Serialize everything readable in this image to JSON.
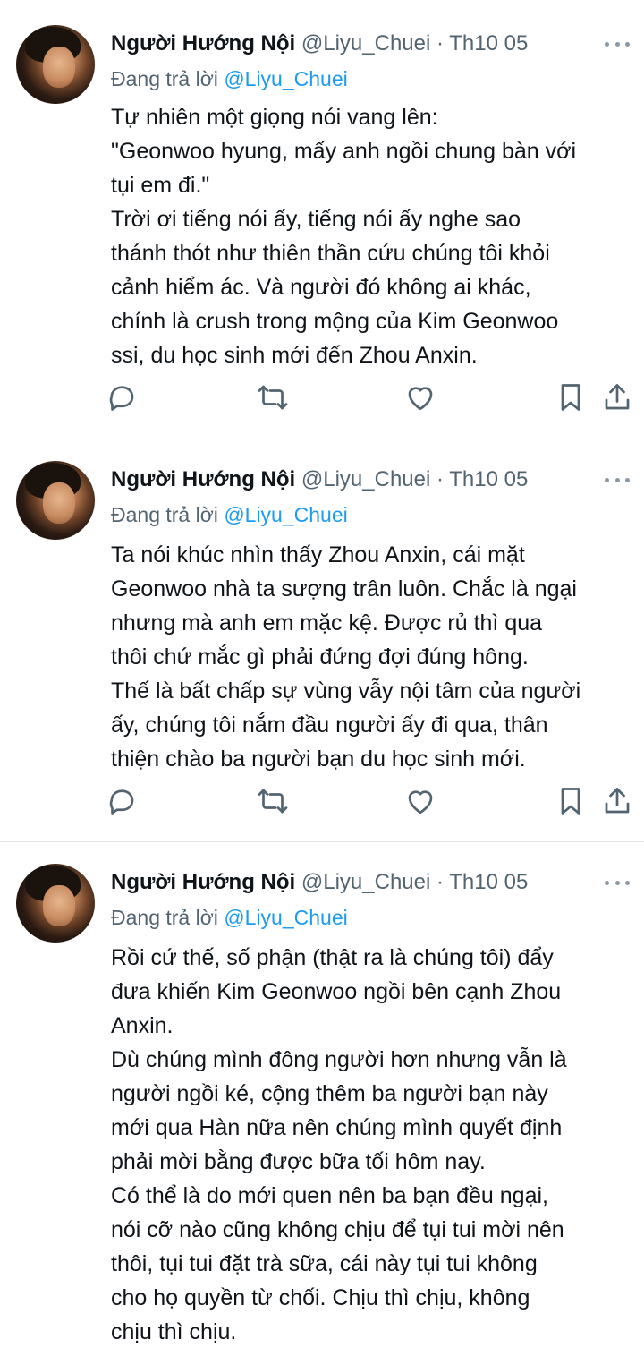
{
  "tweets": [
    {
      "author_name": "Người Hướng Nội",
      "handle": "@Liyu_Chuei",
      "separator": "·",
      "date": "Th10 05",
      "reply_prefix": "Đang trả lời",
      "reply_to": "@Liyu_Chuei",
      "lines": [
        "Tự nhiên một giọng nói vang lên:",
        "\"Geonwoo hyung, mấy anh ngồi chung bàn với",
        "tụi em đi.\"",
        "Trời ơi tiếng nói ấy, tiếng nói ấy nghe sao",
        "thánh thót như thiên thần cứu chúng tôi khỏi",
        "cảnh hiểm ác. Và người đó không ai khác,",
        "chính là crush trong mộng của Kim Geonwoo",
        "ssi, du học sinh mới đến Zhou Anxin."
      ]
    },
    {
      "author_name": "Người Hướng Nội",
      "handle": "@Liyu_Chuei",
      "separator": "·",
      "date": "Th10 05",
      "reply_prefix": "Đang trả lời",
      "reply_to": "@Liyu_Chuei",
      "lines": [
        "Ta nói khúc nhìn thấy Zhou Anxin, cái mặt",
        "Geonwoo nhà ta sượng trân luôn. Chắc là ngại",
        "nhưng mà anh em mặc kệ. Được rủ thì qua",
        "thôi chứ mắc gì phải đứng đợi đúng hông.",
        "Thế là bất chấp sự vùng vẫy nội tâm của người",
        "ấy, chúng tôi nắm đầu người ấy đi qua, thân",
        "thiện chào ba người bạn du học sinh mới."
      ]
    },
    {
      "author_name": "Người Hướng Nội",
      "handle": "@Liyu_Chuei",
      "separator": "·",
      "date": "Th10 05",
      "reply_prefix": "Đang trả lời",
      "reply_to": "@Liyu_Chuei",
      "lines": [
        "Rồi cứ thế, số phận (thật ra là chúng tôi) đẩy",
        "đưa khiến Kim Geonwoo ngồi bên cạnh Zhou",
        "Anxin.",
        "Dù chúng mình đông người hơn nhưng vẫn là",
        "người ngồi ké, cộng thêm ba người bạn này",
        "mới qua Hàn nữa nên chúng mình quyết định",
        "phải mời bằng được bữa tối hôm nay.",
        "Có thể là do mới quen nên ba bạn đều ngại,",
        "nói cỡ nào cũng không chịu để tụi tui mời nên",
        "thôi, tụi tui đặt trà sữa, cái này tụi tui không",
        "cho họ quyền từ chối. Chịu thì chịu, không",
        "chịu thì chịu."
      ]
    }
  ],
  "icons": {
    "reply": "reply-icon",
    "retweet": "retweet-icon",
    "like": "like-icon",
    "bookmark": "bookmark-icon",
    "share": "share-icon",
    "more": "more-icon"
  },
  "colors": {
    "text": "#0f1419",
    "secondary": "#536471",
    "mention": "#1d9bf0",
    "icon": "#536471",
    "divider": "#e1e6ea"
  }
}
